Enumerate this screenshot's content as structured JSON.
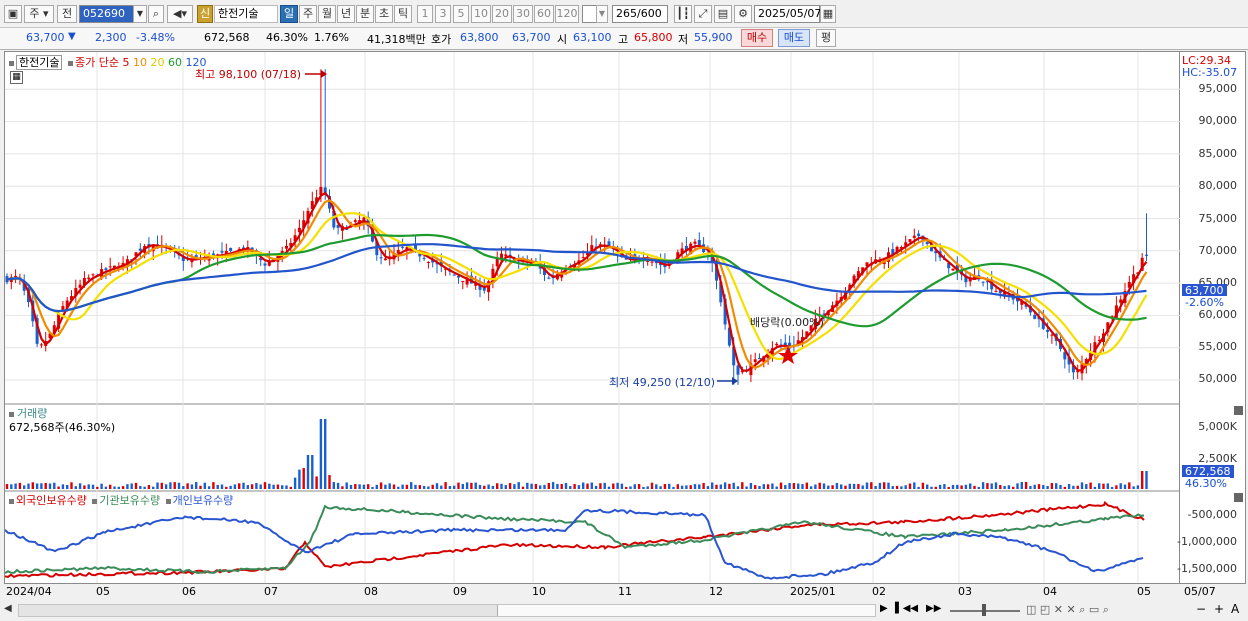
{
  "toolbar": {
    "market": "주",
    "prev": "전",
    "code": "052690",
    "badge": "신",
    "name": "한전기술",
    "periods": [
      "일",
      "주",
      "월",
      "년",
      "분",
      "초",
      "틱"
    ],
    "numbers": [
      "1",
      "3",
      "5",
      "10",
      "20",
      "30",
      "60",
      "120"
    ],
    "count": "265",
    "count_max": "/600",
    "date": "2025/05/07"
  },
  "quote": {
    "price": "63,700",
    "change": "2,300",
    "change_pct": "-3.48%",
    "volume": "672,568",
    "volume_ratio": "46.30%",
    "turnover": "1.76%",
    "amount": "41,318백만",
    "ask_label": "호가",
    "ask": "63,800",
    "bid": "63,700",
    "open_label": "시",
    "open": "63,100",
    "high_label": "고",
    "high": "65,800",
    "low_label": "저",
    "low": "55,900",
    "buy": "매수",
    "sell": "매도",
    "eval": "평"
  },
  "price_panel": {
    "name": "한전기술",
    "ma_label": "종가 단순",
    "ma_periods": [
      "5",
      "10",
      "20",
      "60",
      "120"
    ],
    "high_note": "최고 98,100 (07/18)",
    "low_note": "최저 49,250 (12/10)",
    "dividend_note": "배당락(0.00%)",
    "lc": "LC:29.34",
    "hc": "HC:-35.07",
    "current_tag": "63,700",
    "current_pct": "-2.60%",
    "y_ticks": [
      "95,000",
      "90,000",
      "85,000",
      "80,000",
      "75,000",
      "70,000",
      "65,000",
      "60,000",
      "55,000",
      "50,000"
    ]
  },
  "volume_panel": {
    "title": "거래량",
    "value": "672,568주(46.30%)",
    "y_ticks": [
      "5,000K",
      "2,500K"
    ],
    "tag": "672,568",
    "tag_pct": "46.30%"
  },
  "holding_panel": {
    "series": [
      "외국인보유수량",
      "기관보유수량",
      "개인보유수량"
    ],
    "y_ticks": [
      "-500,000",
      "-1,000,000",
      "-1,500,000"
    ]
  },
  "x_axis": [
    "2024/04",
    "05",
    "06",
    "07",
    "08",
    "09",
    "10",
    "11",
    "12",
    "2025/01",
    "02",
    "03",
    "04",
    "05",
    "05/07"
  ],
  "colors": {
    "up": "#e00000",
    "down": "#1a5fd0",
    "ma5": "#d40000",
    "ma10": "#f08c00",
    "ma20": "#f5e000",
    "ma60": "#1e9b2e",
    "ma120": "#2255cc",
    "foreign": "#d40000",
    "inst": "#3a8a5a",
    "retail": "#2a55d0"
  },
  "chart_data": {
    "type": "candlestick",
    "x_range": [
      "2024/04",
      "2025/05/07"
    ],
    "ylim": [
      48000,
      99000
    ],
    "price_path": [
      [
        0,
        65500
      ],
      [
        14,
        66000
      ],
      [
        25,
        61000
      ],
      [
        33,
        54500
      ],
      [
        45,
        57000
      ],
      [
        60,
        62000
      ],
      [
        80,
        65500
      ],
      [
        100,
        67000
      ],
      [
        120,
        68000
      ],
      [
        140,
        71000
      ],
      [
        160,
        70500
      ],
      [
        180,
        68500
      ],
      [
        200,
        69000
      ],
      [
        220,
        69500
      ],
      [
        240,
        70500
      ],
      [
        260,
        68000
      ],
      [
        280,
        70000
      ],
      [
        295,
        73500
      ],
      [
        305,
        77000
      ],
      [
        318,
        80000
      ],
      [
        330,
        73000
      ],
      [
        345,
        74000
      ],
      [
        360,
        75000
      ],
      [
        370,
        70000
      ],
      [
        380,
        68500
      ],
      [
        400,
        70500
      ],
      [
        420,
        69000
      ],
      [
        440,
        67000
      ],
      [
        460,
        65500
      ],
      [
        480,
        64000
      ],
      [
        495,
        69500
      ],
      [
        510,
        68500
      ],
      [
        530,
        68000
      ],
      [
        545,
        65500
      ],
      [
        560,
        67500
      ],
      [
        575,
        68500
      ],
      [
        590,
        71000
      ],
      [
        605,
        70500
      ],
      [
        620,
        68500
      ],
      [
        640,
        69000
      ],
      [
        660,
        67500
      ],
      [
        675,
        70000
      ],
      [
        690,
        71000
      ],
      [
        705,
        69500
      ],
      [
        715,
        63000
      ],
      [
        722,
        57000
      ],
      [
        730,
        51000
      ],
      [
        740,
        51500
      ],
      [
        755,
        53500
      ],
      [
        770,
        55500
      ],
      [
        785,
        55000
      ],
      [
        800,
        57000
      ],
      [
        815,
        60000
      ],
      [
        830,
        62000
      ],
      [
        845,
        65000
      ],
      [
        860,
        68000
      ],
      [
        880,
        69000
      ],
      [
        900,
        71000
      ],
      [
        915,
        72500
      ],
      [
        930,
        69500
      ],
      [
        945,
        67500
      ],
      [
        960,
        65500
      ],
      [
        975,
        66000
      ],
      [
        990,
        64000
      ],
      [
        1005,
        63000
      ],
      [
        1020,
        61500
      ],
      [
        1040,
        58000
      ],
      [
        1055,
        55000
      ],
      [
        1070,
        50500
      ],
      [
        1085,
        54500
      ],
      [
        1100,
        58000
      ],
      [
        1115,
        62500
      ],
      [
        1125,
        65500
      ],
      [
        1135,
        67500
      ],
      [
        1140,
        71000
      ],
      [
        1145,
        63700
      ]
    ]
  }
}
